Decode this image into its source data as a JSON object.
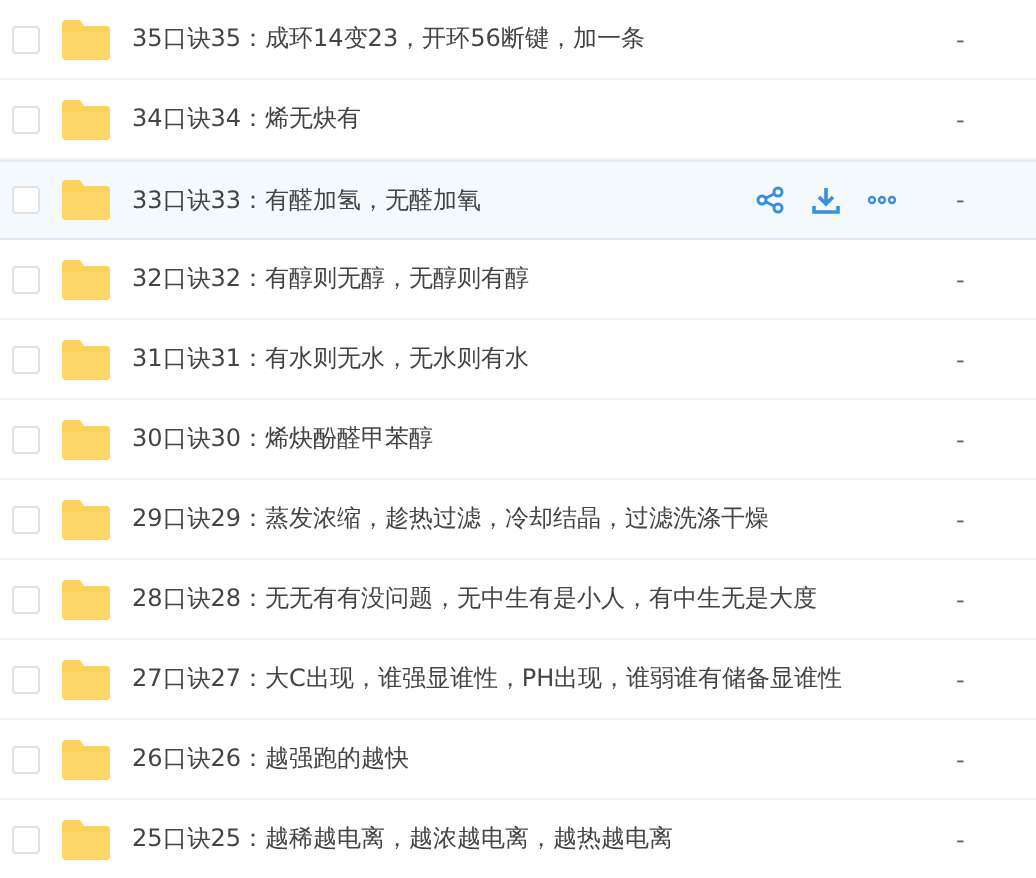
{
  "files": [
    {
      "name": "35口诀35：成环14变23，开环56断键，加一条",
      "size": "-",
      "hovered": false
    },
    {
      "name": "34口诀34：烯无炔有",
      "size": "-",
      "hovered": false
    },
    {
      "name": "33口诀33：有醛加氢，无醛加氧",
      "size": "-",
      "hovered": true
    },
    {
      "name": "32口诀32：有醇则无醇，无醇则有醇",
      "size": "-",
      "hovered": false
    },
    {
      "name": "31口诀31：有水则无水，无水则有水",
      "size": "-",
      "hovered": false
    },
    {
      "name": "30口诀30：烯炔酚醛甲苯醇",
      "size": "-",
      "hovered": false
    },
    {
      "name": "29口诀29：蒸发浓缩，趁热过滤，冷却结晶，过滤洗涤干燥",
      "size": "-",
      "hovered": false
    },
    {
      "name": "28口诀28：无无有有没问题，无中生有是小人，有中生无是大度",
      "size": "-",
      "hovered": false
    },
    {
      "name": "27口诀27：大C出现，谁强显谁性，PH出现，谁弱谁有储备显谁性",
      "size": "-",
      "hovered": false
    },
    {
      "name": "26口诀26：越强跑的越快",
      "size": "-",
      "hovered": false
    },
    {
      "name": "25口诀25：越稀越电离，越浓越电离，越热越电离",
      "size": "-",
      "hovered": false
    }
  ]
}
